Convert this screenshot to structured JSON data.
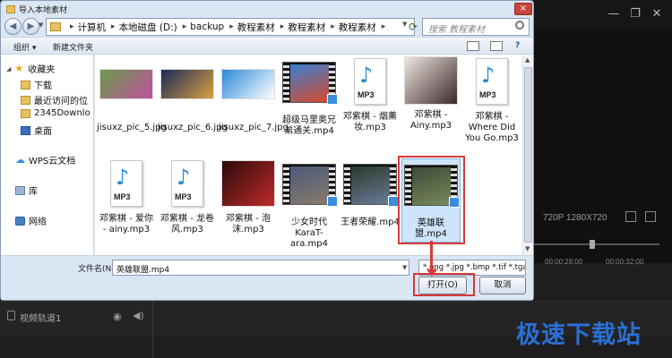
{
  "dialog": {
    "title": "导入本地素材",
    "close_label": "×",
    "nav_back": "◀",
    "nav_forward": "▶",
    "breadcrumbs": [
      "计算机",
      "本地磁盘 (D:)",
      "backup",
      "教程素材",
      "教程素材",
      "教程素材"
    ],
    "search_placeholder": "搜索 教程素材",
    "toolbar": {
      "organize": "组织 ▾",
      "new_folder": "新建文件夹"
    },
    "sidebar": {
      "favorites": "收藏夹",
      "download": "下载",
      "recent": "最近访问的位",
      "folder_2345": "2345Downlo",
      "desktop": "桌面",
      "wps_cloud": "WPS云文档",
      "library": "库",
      "network": "网络"
    },
    "files": [
      {
        "name": "jisuxz_pic_5.jpg",
        "kind": "image",
        "color1": "#6a9b4a",
        "color2": "#c050a0"
      },
      {
        "name": "jisuxz_pic_6.jpg",
        "kind": "image",
        "color1": "#1a2a58",
        "color2": "#d8a040"
      },
      {
        "name": "jisuxz_pic_7.jpg",
        "kind": "image",
        "color1": "#2a8ad8",
        "color2": "#ffffff"
      },
      {
        "name": "超级马里奥兄弟通关.mp4",
        "kind": "video",
        "color1": "#3a7fd0",
        "color2": "#d84a2a"
      },
      {
        "name": "邓紫棋 - 烟薰妆.mp3",
        "kind": "audio"
      },
      {
        "name": "邓紫棋 - Ainy.mp3",
        "kind": "image",
        "color1": "#f0e6e0",
        "color2": "#3a2a2a"
      },
      {
        "name": "邓紫棋 - Where Did You Go.mp3",
        "kind": "audio"
      },
      {
        "name": "邓紫棋 - 爱你 - ainy.mp3",
        "kind": "audio"
      },
      {
        "name": "邓紫棋 - 龙卷风.mp3",
        "kind": "audio"
      },
      {
        "name": "邓紫棋 - 泡沫.mp3",
        "kind": "image",
        "color1": "#2a0a0a",
        "color2": "#c02a2a"
      },
      {
        "name": "少女时代KaraT-ara.mp4",
        "kind": "video",
        "color1": "#4a5a7a",
        "color2": "#8a7a6a"
      },
      {
        "name": "王者荣耀.mp4",
        "kind": "video",
        "color1": "#2a3a2a",
        "color2": "#6a7a9a"
      },
      {
        "name": "英雄联盟.mp4",
        "kind": "video",
        "color1": "#3a4a3a",
        "color2": "#7a8a5a"
      }
    ],
    "filename_label": "文件名(N):",
    "filename_value": "英雄联盟.mp4",
    "filter_value": "*.png *.jpg *.bmp *.tif *.tga *",
    "open_button": "打开(O)",
    "cancel_button": "取消"
  },
  "app": {
    "resolution": "720P 1280X720",
    "ruler_start": "00:00:28;00",
    "ruler_end": "00:00:32;00",
    "track_label": "视频轨道1",
    "min_icon": "—",
    "max_icon": "❐",
    "close_icon": "✕"
  },
  "watermark": "极速下载站"
}
